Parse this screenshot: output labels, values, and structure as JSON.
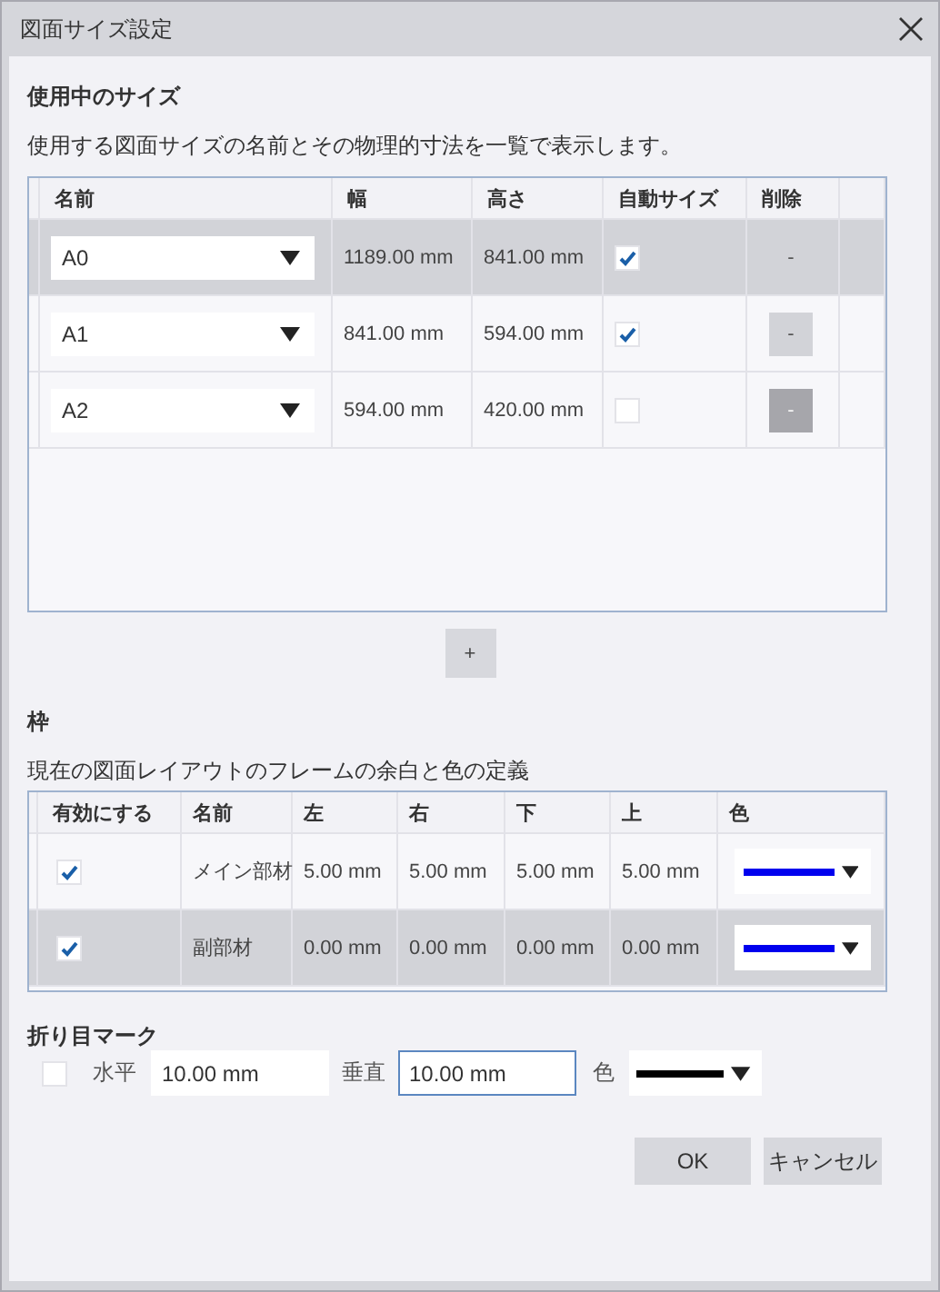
{
  "window": {
    "title": "図面サイズ設定"
  },
  "sizes": {
    "heading": "使用中のサイズ",
    "description": "使用する図面サイズの名前とその物理的寸法を一覧で表示します。",
    "columns": [
      "名前",
      "幅",
      "高さ",
      "自動サイズ",
      "削除"
    ],
    "rows": [
      {
        "name": "A0",
        "width": "1189.00 mm",
        "height": "841.00 mm",
        "auto_size": true,
        "delete": "-",
        "disabled": false,
        "selected": true
      },
      {
        "name": "A1",
        "width": "841.00 mm",
        "height": "594.00 mm",
        "auto_size": true,
        "delete": "-",
        "disabled": false,
        "selected": false
      },
      {
        "name": "A2",
        "width": "594.00 mm",
        "height": "420.00 mm",
        "auto_size": false,
        "delete": "-",
        "disabled": true,
        "selected": false
      }
    ],
    "add_button": "+"
  },
  "frame": {
    "heading": "枠",
    "description": "現在の図面レイアウトのフレームの余白と色の定義",
    "columns": [
      "有効にする",
      "名前",
      "左",
      "右",
      "下",
      "上",
      "色"
    ],
    "rows": [
      {
        "enabled": true,
        "name": "メイン部材",
        "left": "5.00 mm",
        "right": "5.00 mm",
        "bottom": "5.00 mm",
        "top": "5.00 mm",
        "color": "#0000ee",
        "selected": false
      },
      {
        "enabled": true,
        "name": "副部材",
        "left": "0.00 mm",
        "right": "0.00 mm",
        "bottom": "0.00 mm",
        "top": "0.00 mm",
        "color": "#0000ee",
        "selected": true
      }
    ]
  },
  "fold_marks": {
    "heading": "折り目マーク",
    "enabled": false,
    "horizontal_label": "水平",
    "horizontal": "10.00 mm",
    "vertical_label": "垂直",
    "vertical": "10.00 mm",
    "vertical_focused": true,
    "color_label": "色",
    "color": "#000000"
  },
  "buttons": [
    {
      "label": "OK"
    },
    {
      "label": "キャンセル"
    }
  ]
}
